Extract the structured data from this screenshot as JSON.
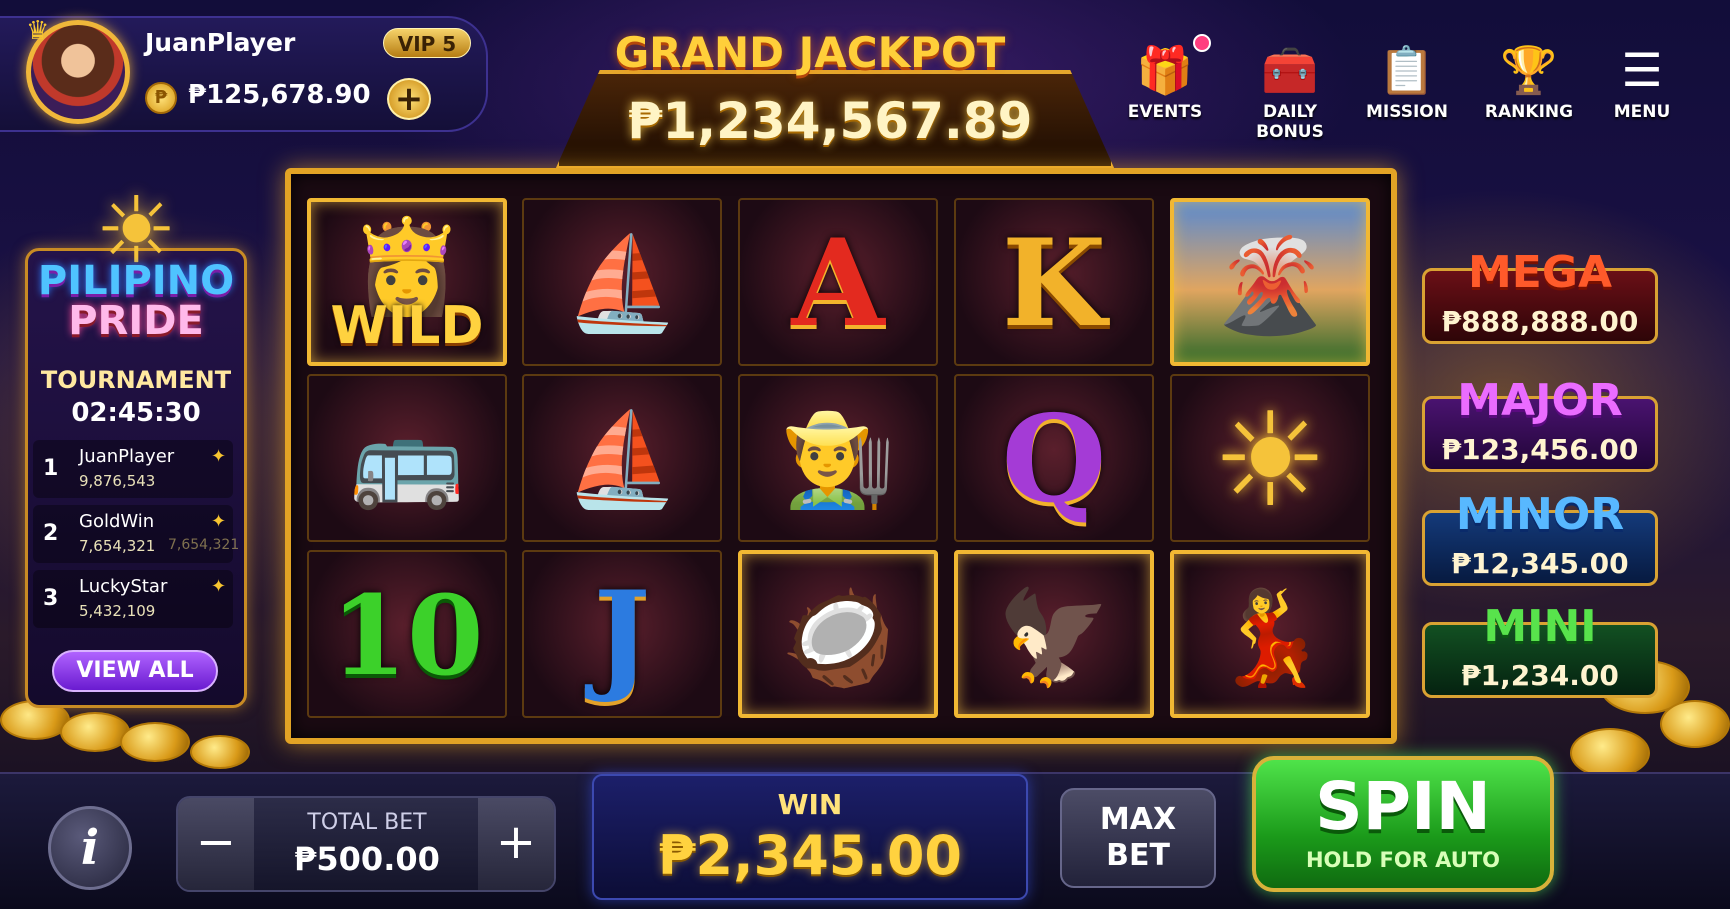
{
  "player": {
    "name": "JuanPlayer",
    "vip": "VIP 5",
    "balance": "₱125,678.90",
    "coin_symbol": "₱"
  },
  "jackpot": {
    "title": "GRAND JACKPOT",
    "value": "₱1,234,567.89"
  },
  "nav": [
    {
      "label": "EVENTS",
      "icon": "gift-icon"
    },
    {
      "label": "DAILY BONUS",
      "icon": "treasure-chest-icon"
    },
    {
      "label": "MISSION",
      "icon": "clipboard-icon"
    },
    {
      "label": "RANKING",
      "icon": "trophy-icon"
    },
    {
      "label": "MENU",
      "icon": "hamburger-menu-icon"
    }
  ],
  "tournament": {
    "title_line1": "PILIPINO",
    "title_line2": "PRIDE",
    "label": "TOURNAMENT",
    "timer": "02:45:30",
    "leaderboard": [
      {
        "rank": "1",
        "name": "JuanPlayer",
        "score": "9,876,543"
      },
      {
        "rank": "2",
        "name": "GoldWin",
        "score": "7,654,321"
      },
      {
        "rank": "3",
        "name": "LuckyStar",
        "score": "5,432,109"
      }
    ],
    "view_all": "VIEW ALL"
  },
  "reels": {
    "symbols": [
      [
        "wild-maiden",
        "jeepney",
        "ten"
      ],
      [
        "sail-emblem",
        "sailboat",
        "jack"
      ],
      [
        "ace",
        "farmer",
        "coconut-drink"
      ],
      [
        "king",
        "queen",
        "eagle"
      ],
      [
        "volcano",
        "sun",
        "festival-dancer"
      ]
    ],
    "wild_label": "WILD",
    "letters": {
      "ace": "A",
      "king": "K",
      "queen": "Q",
      "jack": "J",
      "ten": "10"
    }
  },
  "jackpots": [
    {
      "name": "MEGA",
      "value": "₱888,888.00"
    },
    {
      "name": "MAJOR",
      "value": "₱123,456.00"
    },
    {
      "name": "MINOR",
      "value": "₱12,345.00"
    },
    {
      "name": "MINI",
      "value": "₱1,234.00"
    }
  ],
  "bottom": {
    "info": "i",
    "total_bet_label": "TOTAL BET",
    "total_bet_value": "₱500.00",
    "minus": "−",
    "plus": "+",
    "win_label": "WIN",
    "win_value": "₱2,345.00",
    "max_bet_line1": "MAX",
    "max_bet_line2": "BET",
    "spin_label": "SPIN",
    "spin_sub": "HOLD FOR AUTO"
  }
}
